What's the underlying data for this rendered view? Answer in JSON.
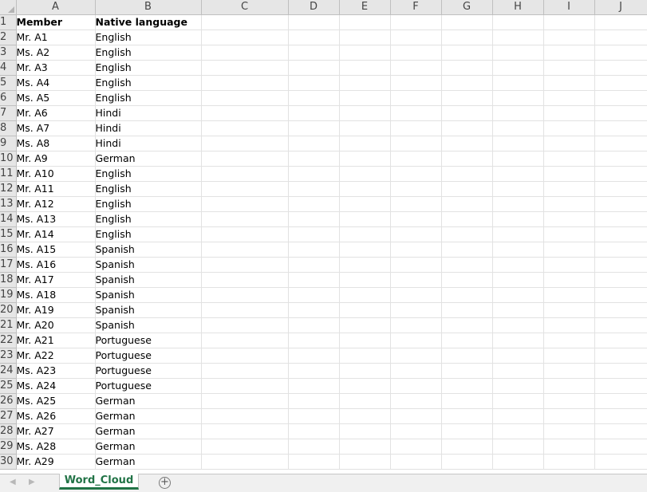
{
  "sheet": {
    "columns": [
      "A",
      "B",
      "C",
      "D",
      "E",
      "F",
      "G",
      "H",
      "I",
      "J"
    ],
    "rows": [
      {
        "num": "1",
        "a": "Member",
        "b": "Native language"
      },
      {
        "num": "2",
        "a": "Mr. A1",
        "b": "English"
      },
      {
        "num": "3",
        "a": "Ms. A2",
        "b": "English"
      },
      {
        "num": "4",
        "a": "Mr. A3",
        "b": "English"
      },
      {
        "num": "5",
        "a": "Ms. A4",
        "b": "English"
      },
      {
        "num": "6",
        "a": "Ms. A5",
        "b": "English"
      },
      {
        "num": "7",
        "a": "Mr. A6",
        "b": "Hindi"
      },
      {
        "num": "8",
        "a": "Ms. A7",
        "b": "Hindi"
      },
      {
        "num": "9",
        "a": "Ms. A8",
        "b": "Hindi"
      },
      {
        "num": "10",
        "a": "Mr. A9",
        "b": "German"
      },
      {
        "num": "11",
        "a": "Mr. A10",
        "b": "English"
      },
      {
        "num": "12",
        "a": "Mr. A11",
        "b": "English"
      },
      {
        "num": "13",
        "a": "Mr. A12",
        "b": "English"
      },
      {
        "num": "14",
        "a": "Ms. A13",
        "b": "English"
      },
      {
        "num": "15",
        "a": "Mr. A14",
        "b": "English"
      },
      {
        "num": "16",
        "a": "Ms. A15",
        "b": "Spanish"
      },
      {
        "num": "17",
        "a": "Ms. A16",
        "b": "Spanish"
      },
      {
        "num": "18",
        "a": "Mr. A17",
        "b": "Spanish"
      },
      {
        "num": "19",
        "a": "Ms. A18",
        "b": "Spanish"
      },
      {
        "num": "20",
        "a": "Mr. A19",
        "b": "Spanish"
      },
      {
        "num": "21",
        "a": "Mr. A20",
        "b": "Spanish"
      },
      {
        "num": "22",
        "a": "Mr. A21",
        "b": "Portuguese"
      },
      {
        "num": "23",
        "a": "Mr. A22",
        "b": "Portuguese"
      },
      {
        "num": "24",
        "a": "Ms. A23",
        "b": "Portuguese"
      },
      {
        "num": "25",
        "a": "Ms. A24",
        "b": "Portuguese"
      },
      {
        "num": "26",
        "a": "Ms. A25",
        "b": "German"
      },
      {
        "num": "27",
        "a": "Ms. A26",
        "b": "German"
      },
      {
        "num": "28",
        "a": "Mr. A27",
        "b": "German"
      },
      {
        "num": "29",
        "a": "Ms. A28",
        "b": "German"
      },
      {
        "num": "30",
        "a": "Mr. A29",
        "b": "German"
      }
    ]
  },
  "tabs": {
    "active": "Word_Cloud",
    "add_symbol": "+",
    "prev_arrow": "◀",
    "next_arrow": "▶"
  },
  "colors": {
    "accent": "#217346",
    "header_bg": "#e6e6e6",
    "gridline": "#e2e2e2"
  }
}
